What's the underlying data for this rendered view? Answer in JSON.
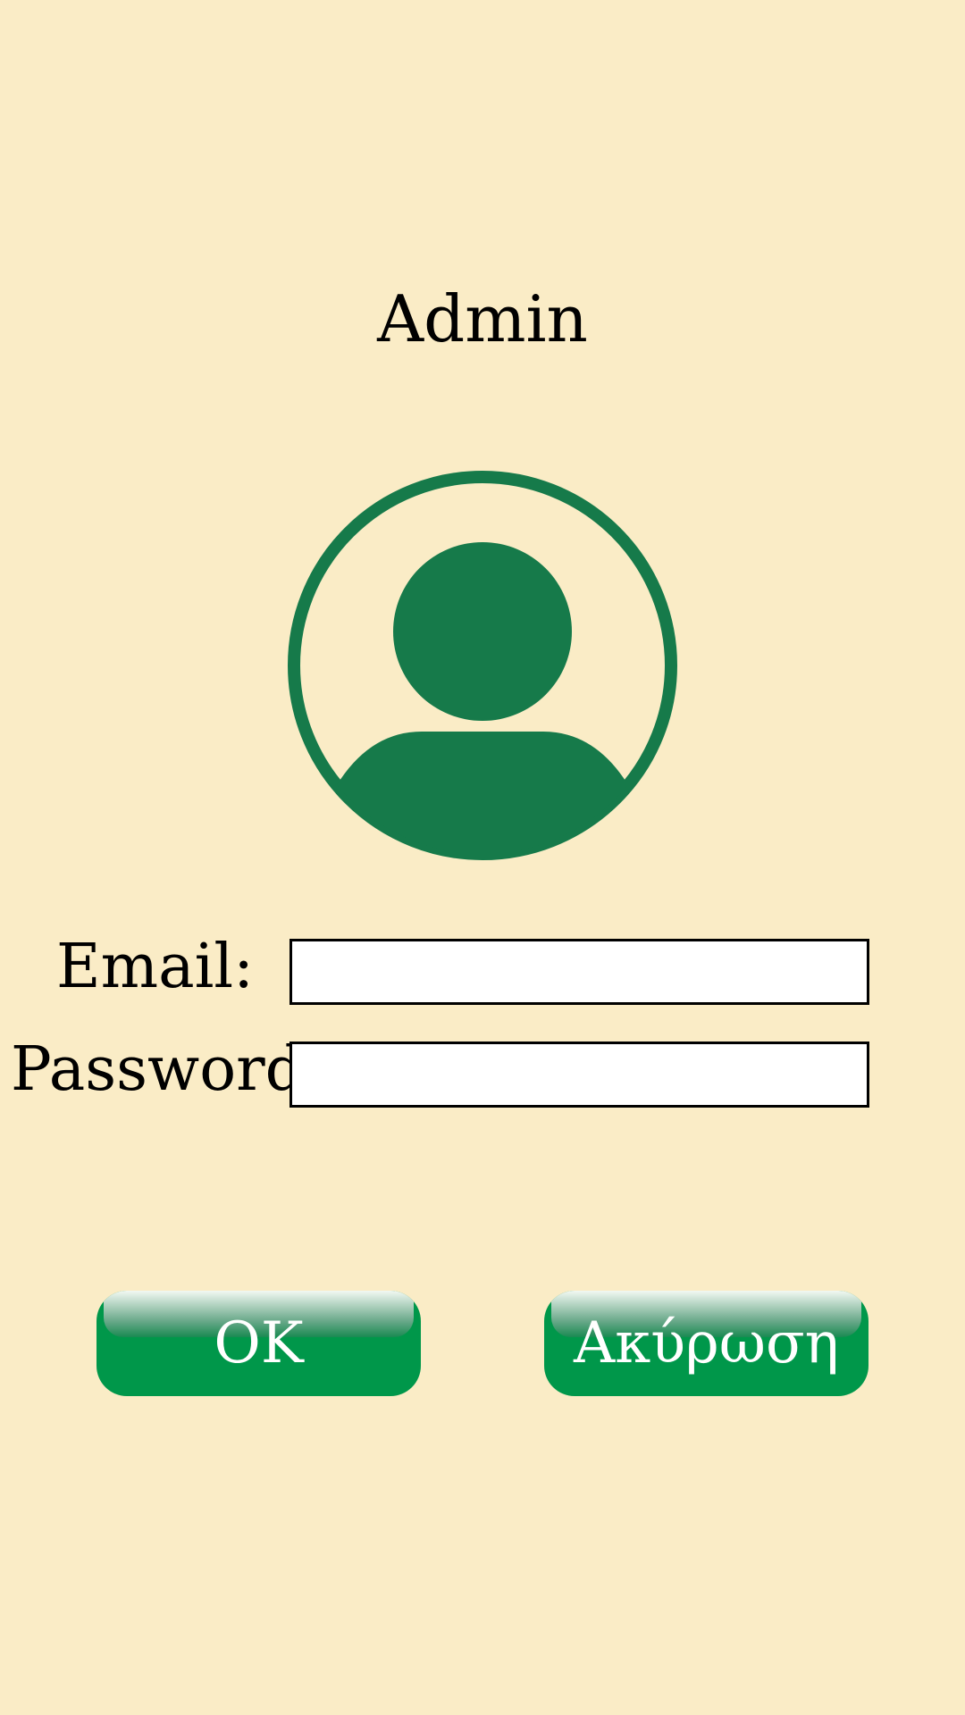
{
  "header": {
    "title": "Admin"
  },
  "form": {
    "email_label": "Email:",
    "email_value": "",
    "password_label": "Password:",
    "password_value": ""
  },
  "buttons": {
    "ok": "OK",
    "cancel": "Ακύρωση"
  },
  "colors": {
    "background": "#faecc6",
    "avatar": "#167a4a",
    "button": "#00974a"
  }
}
